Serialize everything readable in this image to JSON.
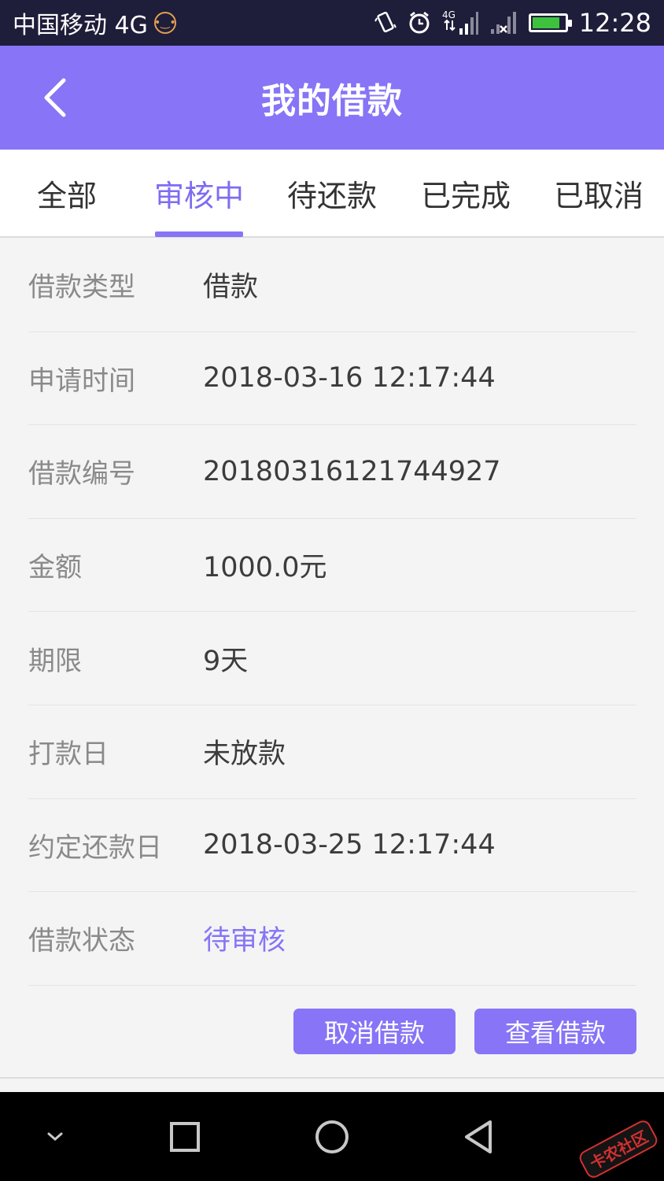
{
  "status_bar": {
    "carrier": "中国移动 4G",
    "network_badge": "4G",
    "time": "12:28",
    "battery_color": "#3ec23e",
    "icons": [
      "emoji-icon",
      "vibrate-icon",
      "alarm-icon",
      "signal-4g-icon",
      "signal-no-sim-icon",
      "battery-icon"
    ]
  },
  "header": {
    "title": "我的借款",
    "back_icon": "chevron-left-icon",
    "background": "#8774f7"
  },
  "tabs": [
    {
      "label": "全部"
    },
    {
      "label": "审核中",
      "active": true
    },
    {
      "label": "待还款"
    },
    {
      "label": "已完成"
    },
    {
      "label": "已取消"
    }
  ],
  "details": [
    {
      "label": "借款类型",
      "value": "借款"
    },
    {
      "label": "申请时间",
      "value": "2018-03-16 12:17:44"
    },
    {
      "label": "借款编号",
      "value": "20180316121744927"
    },
    {
      "label": "金额",
      "value": "1000.0元"
    },
    {
      "label": "期限",
      "value": "9天"
    },
    {
      "label": "打款日",
      "value": "未放款"
    },
    {
      "label": "约定还款日",
      "value": "2018-03-25 12:17:44"
    },
    {
      "label": "借款状态",
      "value": "待审核",
      "highlight": true
    }
  ],
  "actions": {
    "cancel_label": "取消借款",
    "view_label": "查看借款",
    "accent": "#8774f7"
  },
  "nav_bar": {
    "icons": [
      "chevron-down-icon",
      "square-recents-icon",
      "circle-home-icon",
      "triangle-back-icon"
    ]
  },
  "watermark": {
    "text": "卡农社区"
  }
}
